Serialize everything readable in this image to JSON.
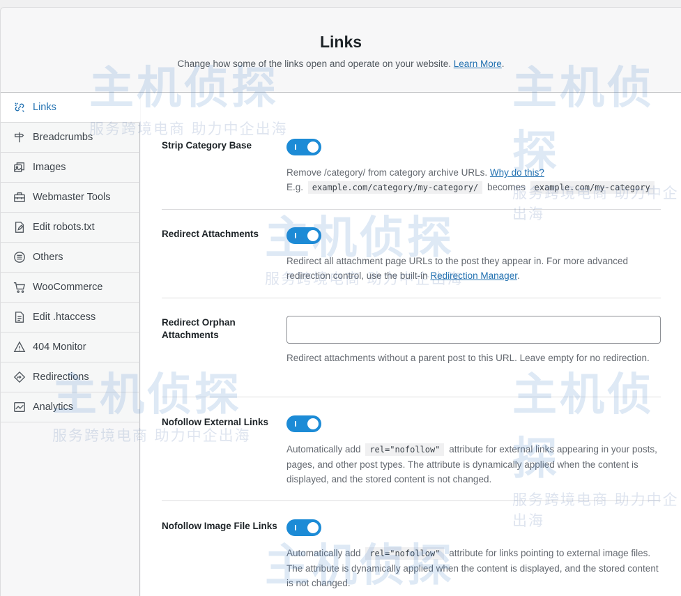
{
  "header": {
    "title": "Links",
    "description": "Change how some of the links open and operate on your website.",
    "learn_more": "Learn More",
    "period": "."
  },
  "sidebar": {
    "items": [
      {
        "label": "Links",
        "icon": "links-icon",
        "active": true
      },
      {
        "label": "Breadcrumbs",
        "icon": "signpost-icon"
      },
      {
        "label": "Images",
        "icon": "images-icon"
      },
      {
        "label": "Webmaster Tools",
        "icon": "toolbox-icon"
      },
      {
        "label": "Edit robots.txt",
        "icon": "edit-file-icon"
      },
      {
        "label": "Others",
        "icon": "list-circle-icon"
      },
      {
        "label": "WooCommerce",
        "icon": "cart-icon"
      },
      {
        "label": "Edit .htaccess",
        "icon": "document-icon"
      },
      {
        "label": "404 Monitor",
        "icon": "warning-icon"
      },
      {
        "label": "Redirections",
        "icon": "redirect-icon"
      },
      {
        "label": "Analytics",
        "icon": "analytics-icon"
      }
    ]
  },
  "settings": {
    "strip_category": {
      "label": "Strip Category Base",
      "enabled": true,
      "desc_text": "Remove /category/ from category archive URLs.",
      "desc_link": "Why do this?",
      "eg": "E.g.",
      "code_from": "example.com/category/my-category/",
      "becomes": "becomes",
      "code_to": "example.com/my-category"
    },
    "redirect_attachments": {
      "label": "Redirect Attachments",
      "enabled": true,
      "desc_text": "Redirect all attachment page URLs to the post they appear in. For more advanced redirection control, use the built-in",
      "desc_link": "Redirection Manager",
      "desc_end": "."
    },
    "redirect_orphan": {
      "label": "Redirect Orphan Attachments",
      "value": "",
      "desc_text": "Redirect attachments without a parent post to this URL. Leave empty for no redirection."
    },
    "nofollow_external": {
      "label": "Nofollow External Links",
      "enabled": true,
      "desc_pre": "Automatically add",
      "code": "rel=\"nofollow\"",
      "desc_post": "attribute for external links appearing in your posts, pages, and other post types. The attribute is dynamically applied when the content is displayed, and the stored content is not changed."
    },
    "nofollow_image": {
      "label": "Nofollow Image File Links",
      "enabled": true,
      "desc_pre": "Automatically add",
      "code": "rel=\"nofollow\"",
      "desc_post": "attribute for links pointing to external image files. The attribute is dynamically applied when the content is displayed, and the stored content is not changed."
    }
  },
  "watermark": {
    "big": "主机侦探",
    "small": "服务跨境电商 助力中企出海"
  },
  "colors": {
    "accent": "#2271b1",
    "toggle_on": "#1c8bd6"
  }
}
